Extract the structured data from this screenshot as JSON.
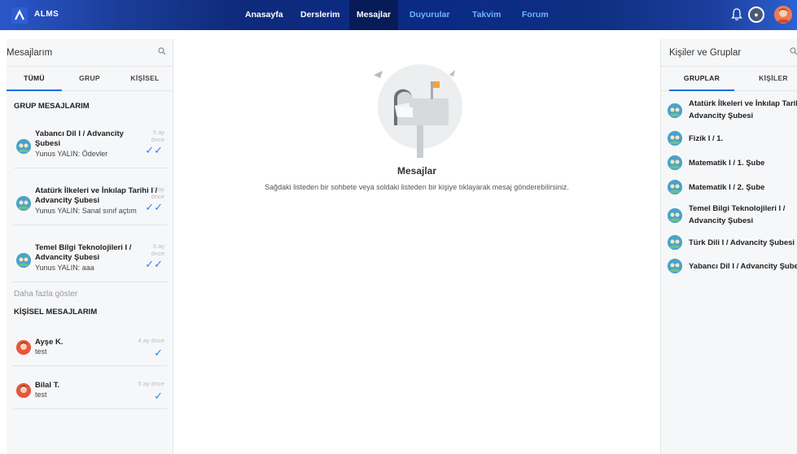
{
  "header": {
    "brand": "ALMS",
    "nav": [
      {
        "label": "Anasayfa"
      },
      {
        "label": "Derslerim"
      },
      {
        "label": "Mesajlar"
      },
      {
        "label": "Duyurular"
      },
      {
        "label": "Takvim"
      },
      {
        "label": "Forum"
      }
    ],
    "icons": [
      "bell-icon",
      "profile-badge-icon",
      "user-avatar"
    ]
  },
  "left_panel": {
    "title": "Mesajlarım",
    "tabs": [
      {
        "label": "TÜMÜ"
      },
      {
        "label": "GRUP"
      },
      {
        "label": "KİŞİSEL"
      }
    ],
    "group_section_title": "GRUP MESAJLARIM",
    "group_messages": [
      {
        "line1": "Yabancı Dil I / Advancity",
        "line2": "Şubesi",
        "preview": "Yunus YALIN: Ödevler",
        "time": "5 ay",
        "time2": "önce"
      },
      {
        "line1": "Atatürk İlkeleri ve İnkılap Tarihi I /",
        "line2": "Advancity Şubesi",
        "preview": "Yunus YALIN: Sanal sınıf açtım",
        "time": "5 ay",
        "time2": "önce"
      },
      {
        "line1": "Temel Bilgi Teknolojileri I /",
        "line2": "Advancity Şubesi",
        "preview": "Yunus YALIN: aaa",
        "time": "5 ay",
        "time2": "önce"
      }
    ],
    "show_more": "Daha fazla göster",
    "personal_section_title": "KİŞİSEL MESAJLARIM",
    "personal_messages": [
      {
        "name": "Ayşe K.",
        "preview": "test",
        "time": "4 ay önce"
      },
      {
        "name": "Bilal T.",
        "preview": "test",
        "time": "5 ay önce"
      }
    ]
  },
  "center": {
    "title": "Mesajlar",
    "description": "Sağdaki listeden bir sohbete veya soldaki listeden bir kişiye tıklayarak mesaj gönderebilirsiniz."
  },
  "right_panel": {
    "title": "Kişiler ve Gruplar",
    "tabs": [
      {
        "label": "GRUPLAR"
      },
      {
        "label": "KİŞİLER"
      }
    ],
    "groups": [
      {
        "line1": "Atatürk İlkeleri ve İnkılap Tarihi I /",
        "line2": "Advancity Şubesi"
      },
      {
        "line1": "Fizik I / 1.",
        "line2": ""
      },
      {
        "line1": "Matematik I / 1. Şube",
        "line2": ""
      },
      {
        "line1": "Matematik I / 2. Şube",
        "line2": ""
      },
      {
        "line1": "Temel Bilgi Teknolojileri I /",
        "line2": "Advancity Şubesi"
      },
      {
        "line1": "Türk Dili I / Advancity Şubesi",
        "line2": ""
      },
      {
        "line1": "Yabancı Dil I / Advancity Şubesi",
        "line2": ""
      }
    ]
  },
  "colors": {
    "accent": "#1e6fe3",
    "nav_active": "#071c57",
    "check": "#2a86e8"
  }
}
